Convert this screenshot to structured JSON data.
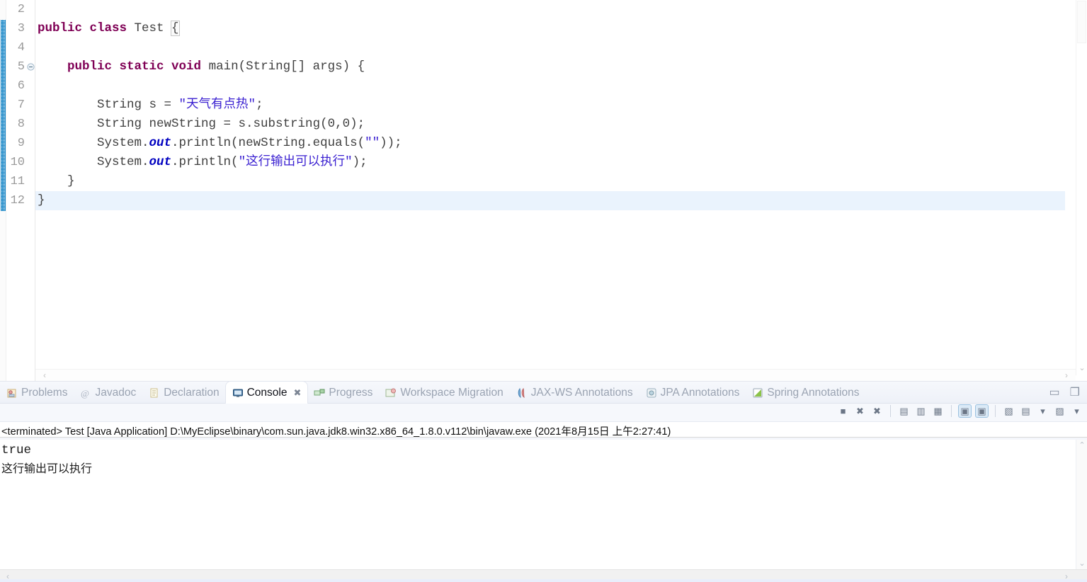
{
  "editor": {
    "first_visible_line": 2,
    "lines": [
      {
        "num": 2,
        "folding": false,
        "current": false,
        "tokens": []
      },
      {
        "num": 3,
        "folding": false,
        "current": false,
        "tokens": [
          {
            "t": "public ",
            "c": "kw"
          },
          {
            "t": "class ",
            "c": "kw"
          },
          {
            "t": "Test ",
            "c": "plain"
          },
          {
            "t": "{",
            "c": "brk"
          }
        ]
      },
      {
        "num": 4,
        "folding": false,
        "current": false,
        "tokens": []
      },
      {
        "num": 5,
        "folding": true,
        "current": false,
        "tokens": [
          {
            "t": "    ",
            "c": "plain"
          },
          {
            "t": "public ",
            "c": "kw"
          },
          {
            "t": "static ",
            "c": "kw"
          },
          {
            "t": "void ",
            "c": "kw"
          },
          {
            "t": "main(String[] args) {",
            "c": "plain"
          }
        ]
      },
      {
        "num": 6,
        "folding": false,
        "current": false,
        "tokens": []
      },
      {
        "num": 7,
        "folding": false,
        "current": false,
        "tokens": [
          {
            "t": "        String s = ",
            "c": "plain"
          },
          {
            "t": "\"天气有点热\"",
            "c": "str"
          },
          {
            "t": ";",
            "c": "plain"
          }
        ]
      },
      {
        "num": 8,
        "folding": false,
        "current": false,
        "tokens": [
          {
            "t": "        String newString = s.substring(0,0);",
            "c": "plain"
          }
        ]
      },
      {
        "num": 9,
        "folding": false,
        "current": false,
        "tokens": [
          {
            "t": "        System.",
            "c": "plain"
          },
          {
            "t": "out",
            "c": "field"
          },
          {
            "t": ".println(newString.equals(",
            "c": "plain"
          },
          {
            "t": "\"\"",
            "c": "str"
          },
          {
            "t": "));",
            "c": "plain"
          }
        ]
      },
      {
        "num": 10,
        "folding": false,
        "current": false,
        "tokens": [
          {
            "t": "        System.",
            "c": "plain"
          },
          {
            "t": "out",
            "c": "field"
          },
          {
            "t": ".println(",
            "c": "plain"
          },
          {
            "t": "\"这行输出可以执行\"",
            "c": "str"
          },
          {
            "t": ");",
            "c": "plain"
          }
        ]
      },
      {
        "num": 11,
        "folding": false,
        "current": false,
        "tokens": [
          {
            "t": "    }",
            "c": "plain"
          }
        ]
      },
      {
        "num": 12,
        "folding": false,
        "current": true,
        "tokens": [
          {
            "t": "}",
            "c": "plain"
          }
        ]
      }
    ],
    "scroll_left_arrow": "‹",
    "scroll_right_arrow": "›",
    "scroll_down_arrow": "⌄"
  },
  "bottom_panel": {
    "tabs": [
      {
        "label": "Problems",
        "icon": "problems-icon",
        "active": false,
        "closable": false
      },
      {
        "label": "Javadoc",
        "icon": "javadoc-icon",
        "active": false,
        "closable": false
      },
      {
        "label": "Declaration",
        "icon": "declaration-icon",
        "active": false,
        "closable": false
      },
      {
        "label": "Console",
        "icon": "console-icon",
        "active": true,
        "closable": true
      },
      {
        "label": "Progress",
        "icon": "progress-icon",
        "active": false,
        "closable": false
      },
      {
        "label": "Workspace Migration",
        "icon": "workspace-migration-icon",
        "active": false,
        "closable": false
      },
      {
        "label": "JAX-WS Annotations",
        "icon": "jaxws-icon",
        "active": false,
        "closable": false
      },
      {
        "label": "JPA Annotations",
        "icon": "jpa-icon",
        "active": false,
        "closable": false
      },
      {
        "label": "Spring Annotations",
        "icon": "spring-icon",
        "active": false,
        "closable": false
      }
    ],
    "close_glyph": "✖",
    "window_buttons": [
      {
        "name": "minimize-button",
        "glyph": "▭"
      },
      {
        "name": "maximize-button",
        "glyph": "❐"
      }
    ],
    "toolbar_buttons": [
      {
        "name": "terminate-button",
        "glyph": "■",
        "selected": false
      },
      {
        "name": "remove-launch-button",
        "glyph": "✖",
        "selected": false
      },
      {
        "name": "remove-all-launches-button",
        "glyph": "✖",
        "selected": false
      },
      {
        "name": "clear-console-button",
        "glyph": "▤",
        "selected": false
      },
      {
        "name": "scroll-lock-button",
        "glyph": "▥",
        "selected": false
      },
      {
        "name": "word-wrap-button",
        "glyph": "▦",
        "selected": false
      },
      {
        "name": "show-console-on-output-button",
        "glyph": "▣",
        "selected": true
      },
      {
        "name": "show-console-on-error-button",
        "glyph": "▣",
        "selected": true
      },
      {
        "name": "pin-console-button",
        "glyph": "▧",
        "selected": false
      },
      {
        "name": "display-selected-console-button",
        "glyph": "▤",
        "selected": false
      },
      {
        "name": "display-console-dropdown",
        "glyph": "▾",
        "selected": false
      },
      {
        "name": "open-console-button",
        "glyph": "▨",
        "selected": false
      },
      {
        "name": "open-console-dropdown",
        "glyph": "▾",
        "selected": false
      }
    ],
    "console": {
      "process_line": "<terminated> Test [Java Application] D:\\MyEclipse\\binary\\com.sun.java.jdk8.win32.x86_64_1.8.0.v112\\bin\\javaw.exe (2021年8月15日 上午2:27:41)",
      "output_lines": [
        "true",
        "这行输出可以执行"
      ],
      "scroll_up_arrow": "⌃",
      "scroll_down_arrow": "⌄",
      "scroll_left_arrow": "‹",
      "scroll_right_arrow": "›"
    }
  },
  "colors": {
    "keyword": "#7f0055",
    "string": "#3b21d1",
    "static_field": "#0000c0",
    "plain_code": "#404040",
    "current_line": "#eaf3fd",
    "change_bar": "#0a7fc4",
    "panel_bg": "#f4f6fb",
    "tab_inactive_text": "#9aa3b2",
    "tab_active_text": "#11131a"
  }
}
